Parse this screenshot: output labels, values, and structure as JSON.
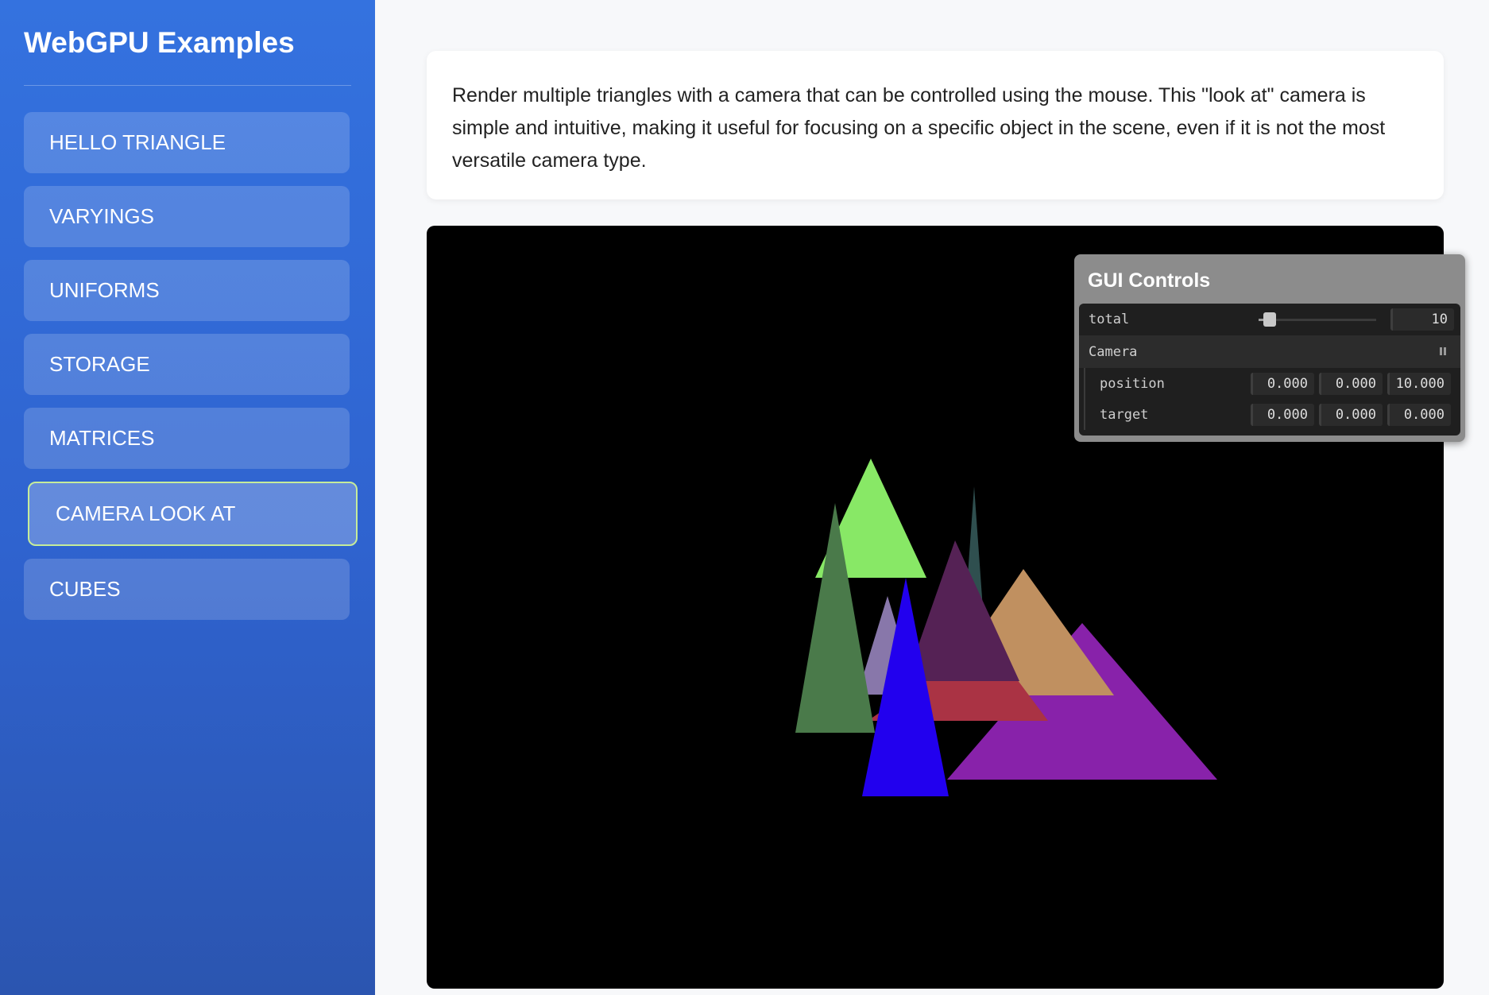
{
  "sidebar": {
    "title": "WebGPU Examples",
    "items": [
      {
        "label": "HELLO TRIANGLE",
        "active": false
      },
      {
        "label": "VARYINGS",
        "active": false
      },
      {
        "label": "UNIFORMS",
        "active": false
      },
      {
        "label": "STORAGE",
        "active": false
      },
      {
        "label": "MATRICES",
        "active": false
      },
      {
        "label": "CAMERA LOOK AT",
        "active": true
      },
      {
        "label": "CUBES",
        "active": false
      }
    ]
  },
  "main": {
    "description": "Render multiple triangles with a camera that can be controlled using the mouse. This \"look at\" camera is simple and intuitive, making it useful for focusing on a specific object in the scene, even if it is not the most versatile camera type."
  },
  "gui": {
    "title": "GUI Controls",
    "total": {
      "label": "total",
      "value": "10",
      "fraction": 0.1
    },
    "camera": {
      "label": "Camera",
      "position": {
        "label": "position",
        "x": "0.000",
        "y": "0.000",
        "z": "10.000"
      },
      "target": {
        "label": "target",
        "x": "0.000",
        "y": "0.000",
        "z": "0.000"
      }
    }
  },
  "scene": {
    "background": "#000000",
    "triangle_colors": [
      "#2f4f4f",
      "#8822aa",
      "#c09060",
      "#aa3344",
      "#8877aa",
      "#552255",
      "#88e866",
      "#4a7a4a",
      "#2200ee"
    ]
  }
}
